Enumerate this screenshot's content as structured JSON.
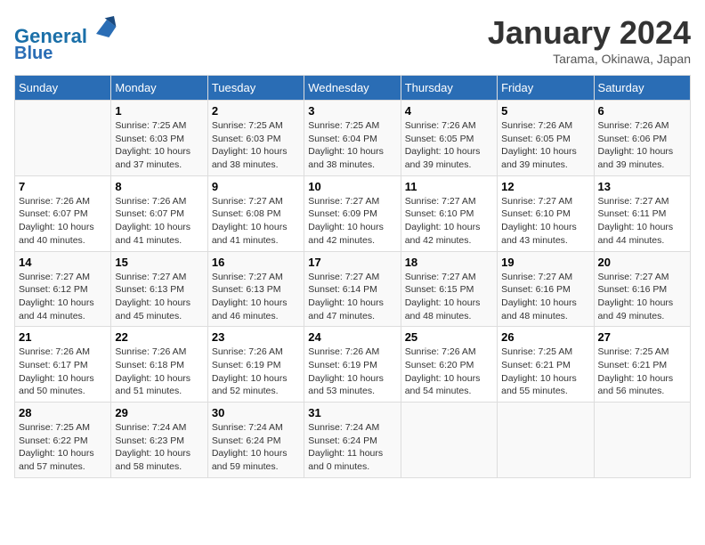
{
  "header": {
    "logo_line1": "General",
    "logo_line2": "Blue",
    "month": "January 2024",
    "location": "Tarama, Okinawa, Japan"
  },
  "days_of_week": [
    "Sunday",
    "Monday",
    "Tuesday",
    "Wednesday",
    "Thursday",
    "Friday",
    "Saturday"
  ],
  "weeks": [
    [
      {
        "day": "",
        "info": ""
      },
      {
        "day": "1",
        "info": "Sunrise: 7:25 AM\nSunset: 6:03 PM\nDaylight: 10 hours\nand 37 minutes."
      },
      {
        "day": "2",
        "info": "Sunrise: 7:25 AM\nSunset: 6:03 PM\nDaylight: 10 hours\nand 38 minutes."
      },
      {
        "day": "3",
        "info": "Sunrise: 7:25 AM\nSunset: 6:04 PM\nDaylight: 10 hours\nand 38 minutes."
      },
      {
        "day": "4",
        "info": "Sunrise: 7:26 AM\nSunset: 6:05 PM\nDaylight: 10 hours\nand 39 minutes."
      },
      {
        "day": "5",
        "info": "Sunrise: 7:26 AM\nSunset: 6:05 PM\nDaylight: 10 hours\nand 39 minutes."
      },
      {
        "day": "6",
        "info": "Sunrise: 7:26 AM\nSunset: 6:06 PM\nDaylight: 10 hours\nand 39 minutes."
      }
    ],
    [
      {
        "day": "7",
        "info": "Sunrise: 7:26 AM\nSunset: 6:07 PM\nDaylight: 10 hours\nand 40 minutes."
      },
      {
        "day": "8",
        "info": "Sunrise: 7:26 AM\nSunset: 6:07 PM\nDaylight: 10 hours\nand 41 minutes."
      },
      {
        "day": "9",
        "info": "Sunrise: 7:27 AM\nSunset: 6:08 PM\nDaylight: 10 hours\nand 41 minutes."
      },
      {
        "day": "10",
        "info": "Sunrise: 7:27 AM\nSunset: 6:09 PM\nDaylight: 10 hours\nand 42 minutes."
      },
      {
        "day": "11",
        "info": "Sunrise: 7:27 AM\nSunset: 6:10 PM\nDaylight: 10 hours\nand 42 minutes."
      },
      {
        "day": "12",
        "info": "Sunrise: 7:27 AM\nSunset: 6:10 PM\nDaylight: 10 hours\nand 43 minutes."
      },
      {
        "day": "13",
        "info": "Sunrise: 7:27 AM\nSunset: 6:11 PM\nDaylight: 10 hours\nand 44 minutes."
      }
    ],
    [
      {
        "day": "14",
        "info": "Sunrise: 7:27 AM\nSunset: 6:12 PM\nDaylight: 10 hours\nand 44 minutes."
      },
      {
        "day": "15",
        "info": "Sunrise: 7:27 AM\nSunset: 6:13 PM\nDaylight: 10 hours\nand 45 minutes."
      },
      {
        "day": "16",
        "info": "Sunrise: 7:27 AM\nSunset: 6:13 PM\nDaylight: 10 hours\nand 46 minutes."
      },
      {
        "day": "17",
        "info": "Sunrise: 7:27 AM\nSunset: 6:14 PM\nDaylight: 10 hours\nand 47 minutes."
      },
      {
        "day": "18",
        "info": "Sunrise: 7:27 AM\nSunset: 6:15 PM\nDaylight: 10 hours\nand 48 minutes."
      },
      {
        "day": "19",
        "info": "Sunrise: 7:27 AM\nSunset: 6:16 PM\nDaylight: 10 hours\nand 48 minutes."
      },
      {
        "day": "20",
        "info": "Sunrise: 7:27 AM\nSunset: 6:16 PM\nDaylight: 10 hours\nand 49 minutes."
      }
    ],
    [
      {
        "day": "21",
        "info": "Sunrise: 7:26 AM\nSunset: 6:17 PM\nDaylight: 10 hours\nand 50 minutes."
      },
      {
        "day": "22",
        "info": "Sunrise: 7:26 AM\nSunset: 6:18 PM\nDaylight: 10 hours\nand 51 minutes."
      },
      {
        "day": "23",
        "info": "Sunrise: 7:26 AM\nSunset: 6:19 PM\nDaylight: 10 hours\nand 52 minutes."
      },
      {
        "day": "24",
        "info": "Sunrise: 7:26 AM\nSunset: 6:19 PM\nDaylight: 10 hours\nand 53 minutes."
      },
      {
        "day": "25",
        "info": "Sunrise: 7:26 AM\nSunset: 6:20 PM\nDaylight: 10 hours\nand 54 minutes."
      },
      {
        "day": "26",
        "info": "Sunrise: 7:25 AM\nSunset: 6:21 PM\nDaylight: 10 hours\nand 55 minutes."
      },
      {
        "day": "27",
        "info": "Sunrise: 7:25 AM\nSunset: 6:21 PM\nDaylight: 10 hours\nand 56 minutes."
      }
    ],
    [
      {
        "day": "28",
        "info": "Sunrise: 7:25 AM\nSunset: 6:22 PM\nDaylight: 10 hours\nand 57 minutes."
      },
      {
        "day": "29",
        "info": "Sunrise: 7:24 AM\nSunset: 6:23 PM\nDaylight: 10 hours\nand 58 minutes."
      },
      {
        "day": "30",
        "info": "Sunrise: 7:24 AM\nSunset: 6:24 PM\nDaylight: 10 hours\nand 59 minutes."
      },
      {
        "day": "31",
        "info": "Sunrise: 7:24 AM\nSunset: 6:24 PM\nDaylight: 11 hours\nand 0 minutes."
      },
      {
        "day": "",
        "info": ""
      },
      {
        "day": "",
        "info": ""
      },
      {
        "day": "",
        "info": ""
      }
    ]
  ]
}
